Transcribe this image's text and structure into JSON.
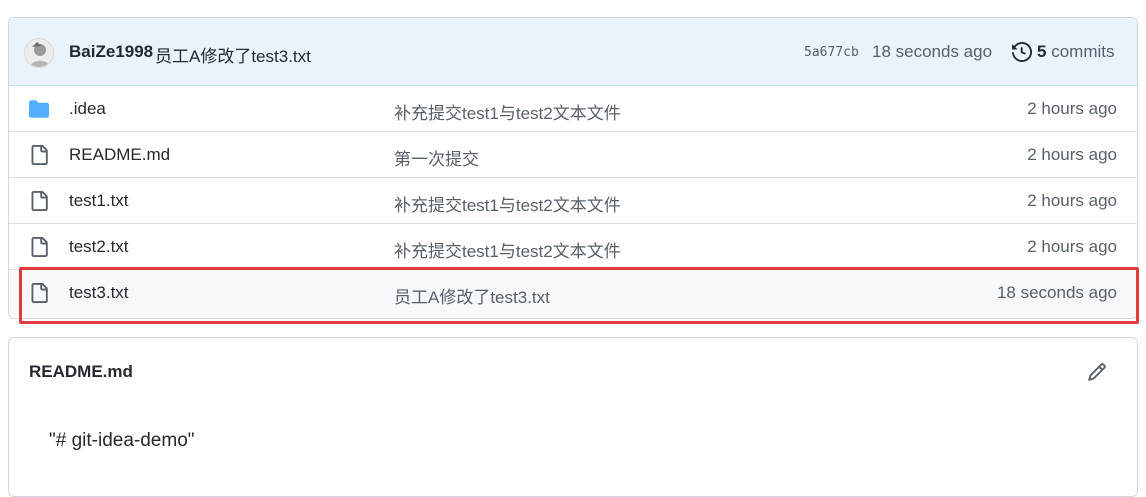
{
  "commit": {
    "author": "BaiZe1998",
    "message": "员工A修改了test3.txt",
    "sha": "5a677cb",
    "time": "18 seconds ago",
    "commits_count": "5",
    "commits_label": "commits"
  },
  "files": [
    {
      "name": ".idea",
      "type": "folder",
      "icon": "folder-icon",
      "message": "补充提交test1与test2文本文件",
      "time": "2 hours ago"
    },
    {
      "name": "README.md",
      "type": "file",
      "icon": "file-icon",
      "message": "第一次提交",
      "time": "2 hours ago"
    },
    {
      "name": "test1.txt",
      "type": "file",
      "icon": "file-icon",
      "message": "补充提交test1与test2文本文件",
      "time": "2 hours ago"
    },
    {
      "name": "test2.txt",
      "type": "file",
      "icon": "file-icon",
      "message": "补充提交test1与test2文本文件",
      "time": "2 hours ago"
    },
    {
      "name": "test3.txt",
      "type": "file",
      "icon": "file-icon",
      "message": "员工A修改了test3.txt",
      "time": "18 seconds ago"
    }
  ],
  "readme": {
    "title": "README.md",
    "content": "\"# git-idea-demo\"",
    "edit_icon": "pencil-icon"
  },
  "colors": {
    "highlight": "#e03a3e",
    "folder": "#54aeff",
    "commit_bar": "#eaf3fc"
  }
}
